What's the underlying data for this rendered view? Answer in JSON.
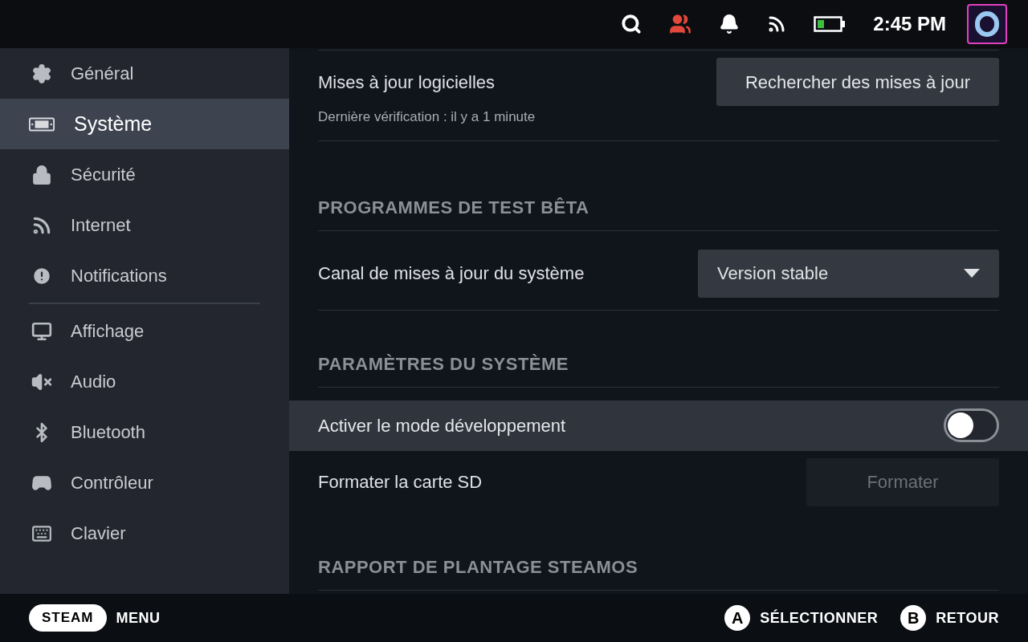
{
  "status_bar": {
    "time": "2:45 PM"
  },
  "sidebar": {
    "groups": [
      {
        "items": [
          {
            "label": "Général",
            "selected": false
          },
          {
            "label": "Système",
            "selected": true
          },
          {
            "label": "Sécurité",
            "selected": false
          },
          {
            "label": "Internet",
            "selected": false
          },
          {
            "label": "Notifications",
            "selected": false
          }
        ]
      },
      {
        "items": [
          {
            "label": "Affichage",
            "selected": false
          },
          {
            "label": "Audio",
            "selected": false
          },
          {
            "label": "Bluetooth",
            "selected": false
          },
          {
            "label": "Contrôleur",
            "selected": false
          },
          {
            "label": "Clavier",
            "selected": false
          }
        ]
      }
    ]
  },
  "content": [
    {
      "kind": "button_row",
      "label": "Mises à jour logicielles",
      "button": "Rechercher des mises à jour",
      "disabled": false,
      "focused": false
    },
    {
      "kind": "note",
      "text": "Dernière vérification : il y a 1 minute"
    },
    {
      "kind": "heading",
      "text": "PROGRAMMES DE TEST BÊTA"
    },
    {
      "kind": "dropdown_row",
      "label": "Canal de mises à jour du système",
      "value": "Version stable",
      "focused": false
    },
    {
      "kind": "heading",
      "text": "PARAMÈTRES DU SYSTÈME"
    },
    {
      "kind": "toggle_row",
      "label": "Activer le mode développement",
      "on": false,
      "focused": true
    },
    {
      "kind": "button_row",
      "label": "Formater la carte SD",
      "button": "Formater",
      "disabled": true,
      "focused": false
    },
    {
      "kind": "heading",
      "text": "RAPPORT DE PLANTAGE STEAMOS"
    }
  ],
  "footer": {
    "steam": "STEAM",
    "menu": "MENU",
    "hints": [
      {
        "key": "A",
        "label": "SÉLECTIONNER"
      },
      {
        "key": "B",
        "label": "RETOUR"
      }
    ]
  }
}
